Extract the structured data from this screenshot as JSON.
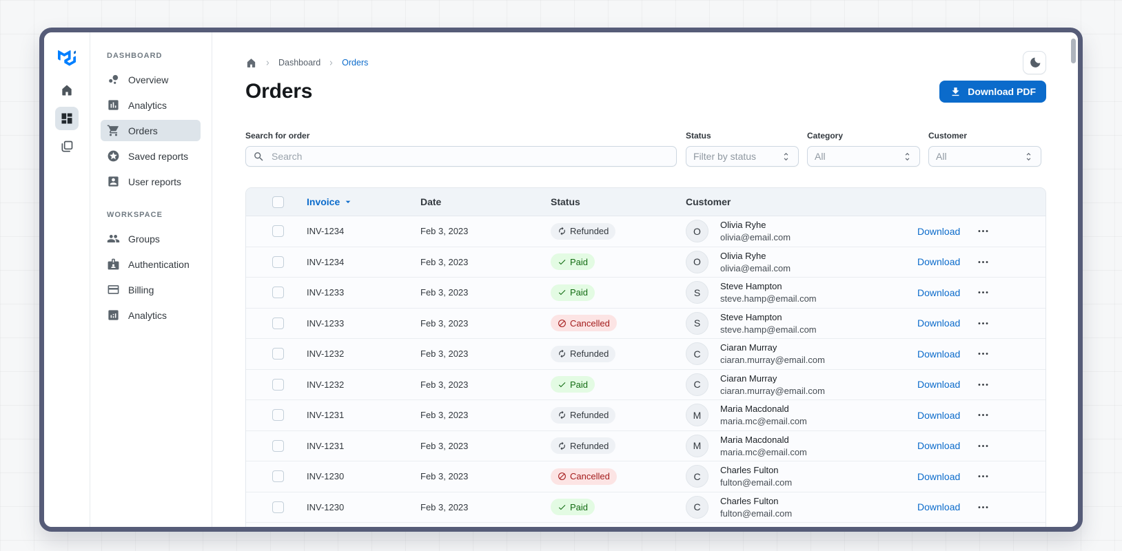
{
  "theme": {
    "primary": "#0b6bcb",
    "frame": "#565c78",
    "sidebar_selected_bg": "#dde4ea",
    "table_header_bg": "#f0f4f8",
    "chip_refunded_bg": "#eef1f5",
    "chip_refunded_text": "#32383e",
    "chip_paid_bg": "#e3fbe3",
    "chip_paid_text": "#136c13",
    "chip_cancelled_bg": "#fce4e4",
    "chip_cancelled_text": "#a31b1b"
  },
  "sidebar": {
    "logo_icon": "mui-logo",
    "rail": [
      {
        "icon": "home"
      },
      {
        "icon": "grid",
        "selected": true
      },
      {
        "icon": "layers"
      }
    ],
    "sections": [
      {
        "title": "DASHBOARD",
        "items": [
          {
            "label": "Overview",
            "icon": "bubble"
          },
          {
            "label": "Analytics",
            "icon": "barchart-sq"
          },
          {
            "label": "Orders",
            "icon": "cart",
            "selected": true
          },
          {
            "label": "Saved reports",
            "icon": "star-circle"
          },
          {
            "label": "User reports",
            "icon": "person-card"
          }
        ]
      },
      {
        "title": "WORKSPACE",
        "items": [
          {
            "label": "Groups",
            "icon": "people"
          },
          {
            "label": "Authentication",
            "icon": "badge"
          },
          {
            "label": "Billing",
            "icon": "credit-card"
          },
          {
            "label": "Analytics",
            "icon": "chart-sq"
          }
        ]
      }
    ]
  },
  "breadcrumb": {
    "home_icon": "home",
    "items": [
      {
        "label": "Dashboard"
      },
      {
        "label": "Orders",
        "state": "current"
      }
    ]
  },
  "header": {
    "title": "Orders",
    "download_button": "Download PDF",
    "theme_toggle_icon": "moon"
  },
  "filters": {
    "search": {
      "label": "Search for order",
      "placeholder": "Search",
      "icon": "search"
    },
    "selects": [
      {
        "label": "Status",
        "value": "Filter by status"
      },
      {
        "label": "Category",
        "value": "All"
      },
      {
        "label": "Customer",
        "value": "All"
      }
    ]
  },
  "table": {
    "columns": {
      "invoice": "Invoice",
      "date": "Date",
      "status": "Status",
      "customer": "Customer"
    },
    "sort_column": "Invoice",
    "download_label": "Download",
    "rows": [
      {
        "invoice": "INV-1234",
        "date": "Feb 3, 2023",
        "status": "Refunded",
        "status_class": "chip-refunded",
        "status_icon": "refresh",
        "initial": "O",
        "name": "Olivia Ryhe",
        "email": "olivia@email.com"
      },
      {
        "invoice": "INV-1234",
        "date": "Feb 3, 2023",
        "status": "Paid",
        "status_class": "chip-paid",
        "status_icon": "check",
        "initial": "O",
        "name": "Olivia Ryhe",
        "email": "olivia@email.com"
      },
      {
        "invoice": "INV-1233",
        "date": "Feb 3, 2023",
        "status": "Paid",
        "status_class": "chip-paid",
        "status_icon": "check",
        "initial": "S",
        "name": "Steve Hampton",
        "email": "steve.hamp@email.com"
      },
      {
        "invoice": "INV-1233",
        "date": "Feb 3, 2023",
        "status": "Cancelled",
        "status_class": "chip-cancelled",
        "status_icon": "block",
        "initial": "S",
        "name": "Steve Hampton",
        "email": "steve.hamp@email.com"
      },
      {
        "invoice": "INV-1232",
        "date": "Feb 3, 2023",
        "status": "Refunded",
        "status_class": "chip-refunded",
        "status_icon": "refresh",
        "initial": "C",
        "name": "Ciaran Murray",
        "email": "ciaran.murray@email.com"
      },
      {
        "invoice": "INV-1232",
        "date": "Feb 3, 2023",
        "status": "Paid",
        "status_class": "chip-paid",
        "status_icon": "check",
        "initial": "C",
        "name": "Ciaran Murray",
        "email": "ciaran.murray@email.com"
      },
      {
        "invoice": "INV-1231",
        "date": "Feb 3, 2023",
        "status": "Refunded",
        "status_class": "chip-refunded",
        "status_icon": "refresh",
        "initial": "M",
        "name": "Maria Macdonald",
        "email": "maria.mc@email.com"
      },
      {
        "invoice": "INV-1231",
        "date": "Feb 3, 2023",
        "status": "Refunded",
        "status_class": "chip-refunded",
        "status_icon": "refresh",
        "initial": "M",
        "name": "Maria Macdonald",
        "email": "maria.mc@email.com"
      },
      {
        "invoice": "INV-1230",
        "date": "Feb 3, 2023",
        "status": "Cancelled",
        "status_class": "chip-cancelled",
        "status_icon": "block",
        "initial": "C",
        "name": "Charles Fulton",
        "email": "fulton@email.com"
      },
      {
        "invoice": "INV-1230",
        "date": "Feb 3, 2023",
        "status": "Paid",
        "status_class": "chip-paid",
        "status_icon": "check",
        "initial": "C",
        "name": "Charles Fulton",
        "email": "fulton@email.com"
      }
    ]
  }
}
